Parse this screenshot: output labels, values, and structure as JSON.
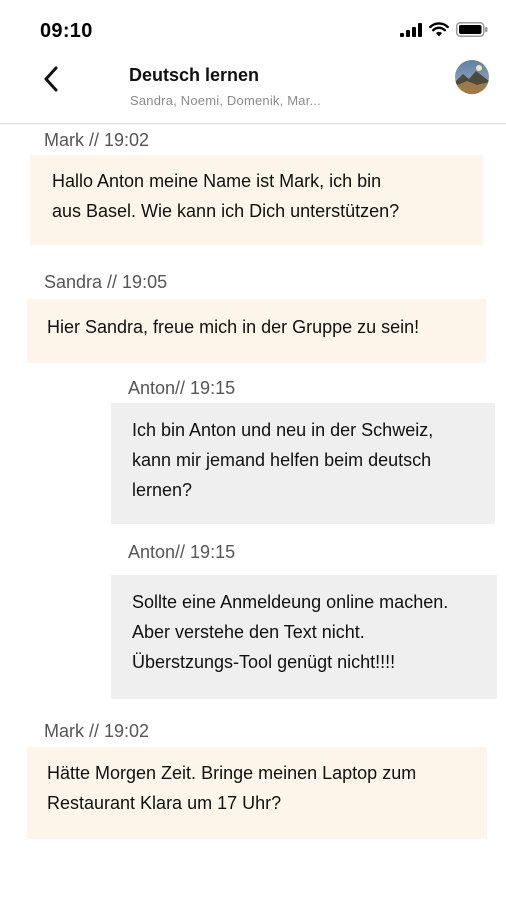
{
  "status_bar": {
    "time": "09:10"
  },
  "header": {
    "title": "Deutsch lernen",
    "subtitle": "Sandra, Noemi, Domenik, Mar..."
  },
  "messages": [
    {
      "meta": "Mark // 19:02",
      "lines": [
        "Hallo Anton meine Name ist Mark, ich bin",
        "aus Basel. Wie kann ich Dich unterstützen?"
      ]
    },
    {
      "meta": "Sandra // 19:05",
      "lines": [
        "Hier Sandra, freue mich in der Gruppe zu sein!"
      ]
    },
    {
      "meta": "Anton// 19:15",
      "lines": [
        "Ich bin Anton und neu in der Schweiz,",
        "kann mir jemand helfen beim deutsch",
        "lernen?"
      ]
    },
    {
      "meta": "Anton// 19:15",
      "lines": [
        "Sollte eine Anmeldeung online machen.",
        "Aber verstehe den Text nicht.",
        "Überstzungs-Tool genügt nicht!!!!"
      ]
    },
    {
      "meta": "Mark // 19:02",
      "lines": [
        "Hätte Morgen Zeit. Bringe meinen Laptop zum",
        "Restaurant Klara um 17 Uhr?"
      ]
    }
  ],
  "icons": {
    "back": "chevron-left-icon",
    "signal": "cellular-signal-icon",
    "wifi": "wifi-icon",
    "battery": "battery-icon",
    "avatar": "group-avatar"
  },
  "colors": {
    "incoming_bubble": "#fdf5ea",
    "outgoing_bubble": "#efefef",
    "meta_text": "#555555",
    "subtitle_text": "#8a8a8a"
  }
}
